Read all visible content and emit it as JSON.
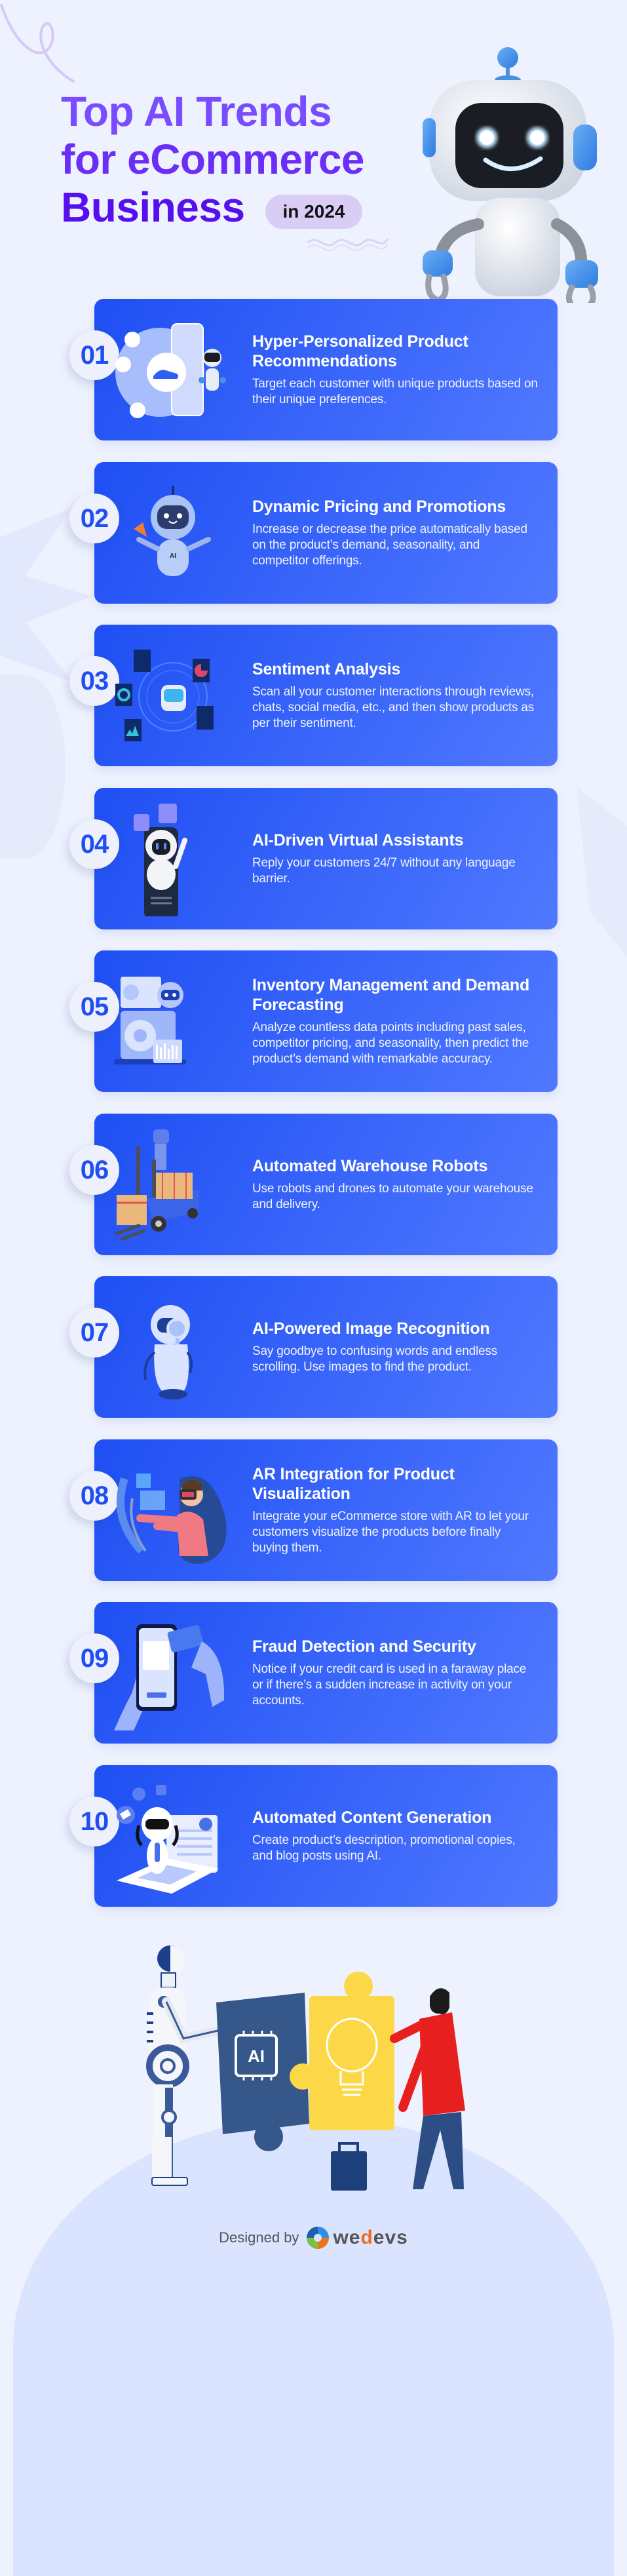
{
  "header": {
    "title_line1": "Top AI Trends",
    "title_line2": "for eCommerce",
    "title_line3": "Business",
    "year_pill": "in 2024"
  },
  "colors": {
    "background": "#eef2fe",
    "card_start": "#1f4ff3",
    "card_end": "#5079ff",
    "title_purple": "#6a2ef7",
    "badge_text": "#1f4ff3",
    "pill_bg": "#d9cdf6"
  },
  "trends": [
    {
      "number": "01",
      "title": "Hyper-Personalized Product Recommendations",
      "description": "Target each customer with unique products based on their unique preferences.",
      "icon": "product-recommendation-icon"
    },
    {
      "number": "02",
      "title": "Dynamic Pricing and Promotions",
      "description": "Increase or decrease the price automatically based on the product’s demand, seasonality, and competitor offerings.",
      "icon": "robot-megaphone-icon"
    },
    {
      "number": "03",
      "title": "Sentiment Analysis",
      "description": "Scan all your customer interactions through reviews, chats, social media, etc., and then show products as per their sentiment.",
      "icon": "sentiment-dashboard-icon"
    },
    {
      "number": "04",
      "title": "AI-Driven Virtual Assistants",
      "description": "Reply your customers 24/7 without any language barrier.",
      "icon": "chatbot-phone-icon"
    },
    {
      "number": "05",
      "title": "Inventory Management and Demand Forecasting",
      "description": "Analyze countless data points including past sales, competitor pricing, and seasonality, then predict the product’s demand with remarkable accuracy.",
      "icon": "forecast-laptop-icon"
    },
    {
      "number": "06",
      "title": "Automated Warehouse Robots",
      "description": "Use robots and drones to automate your warehouse and delivery.",
      "icon": "forklift-robot-icon"
    },
    {
      "number": "07",
      "title": "AI-Powered Image Recognition",
      "description": "Say goodbye to confusing words and endless scrolling. Use images to find the product.",
      "icon": "robot-magnifier-icon"
    },
    {
      "number": "08",
      "title": "AR Integration for Product Visualization",
      "description": "Integrate your eCommerce store with AR to let your customers visualize the products before finally buying them.",
      "icon": "vr-headset-person-icon"
    },
    {
      "number": "09",
      "title": "Fraud Detection and Security",
      "description": "Notice if your credit card is used in a faraway place or if there’s a sudden increase in activity on your accounts.",
      "icon": "credit-card-phone-icon"
    },
    {
      "number": "10",
      "title": "Automated Content Generation",
      "description": "Create product’s description, promotional copies, and blog posts using AI.",
      "icon": "robot-laptop-content-icon"
    }
  ],
  "illustration": {
    "puzzle_left_label": "AI"
  },
  "footer": {
    "designed_by": "Designed by",
    "brand_prefix": "we",
    "brand_accent": "d",
    "brand_suffix": "evs"
  }
}
